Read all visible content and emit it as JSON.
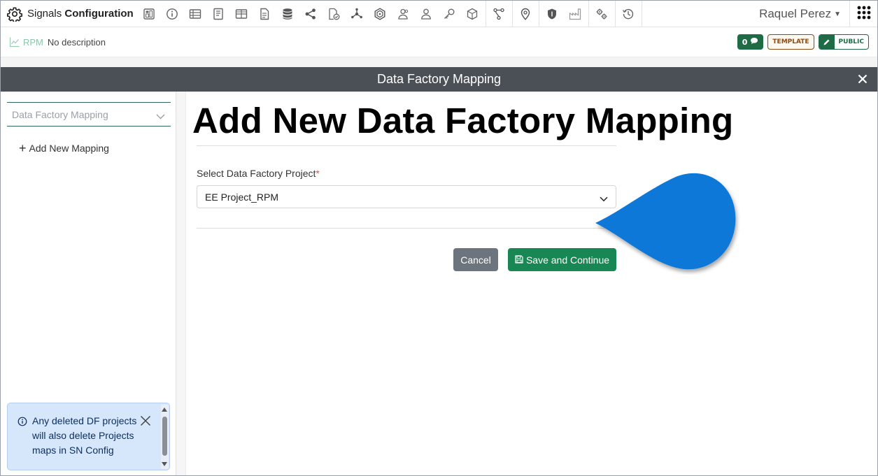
{
  "navbar": {
    "brand_prefix": "Signals",
    "brand_bold": "Configuration",
    "user_name": "Raquel Perez",
    "icons": [
      "dashboard-icon",
      "info-icon",
      "table-icon",
      "notebook-icon",
      "grid-table-icon",
      "document-icon",
      "database-icon",
      "share-icon",
      "file-check-icon",
      "network-icon",
      "hexagon-icon",
      "user-group-icon",
      "user-icon",
      "key-icon",
      "cube-icon",
      "branch-icon",
      "location-icon",
      "shield-icon",
      "factory-icon",
      "gears-icon",
      "history-icon"
    ]
  },
  "subheader": {
    "name": "RPM",
    "description": "No description",
    "comment_count": "0",
    "template_label": "TEMPLATE",
    "public_label": "PUBLIC"
  },
  "modal": {
    "title": "Data Factory Mapping"
  },
  "left_panel": {
    "mapping_placeholder": "Data Factory Mapping",
    "add_mapping_label": "Add New Mapping",
    "info_text": "Any deleted DF projects will also delete Projects maps in SN Config"
  },
  "main": {
    "page_title": "Add New Data Factory Mapping",
    "project_label": "Select Data Factory Project",
    "required_mark": "*",
    "project_value": "EE Project_RPM",
    "cancel_label": "Cancel",
    "save_label": "Save and Continue"
  },
  "colors": {
    "modal_bar": "#4a5056",
    "save_button": "#198754",
    "cancel_button": "#6c757d",
    "info_bg": "#d6e6fb",
    "pointer": "#0a78d7",
    "badge_green": "#1e6b46",
    "badge_template": "#8a4b14"
  }
}
